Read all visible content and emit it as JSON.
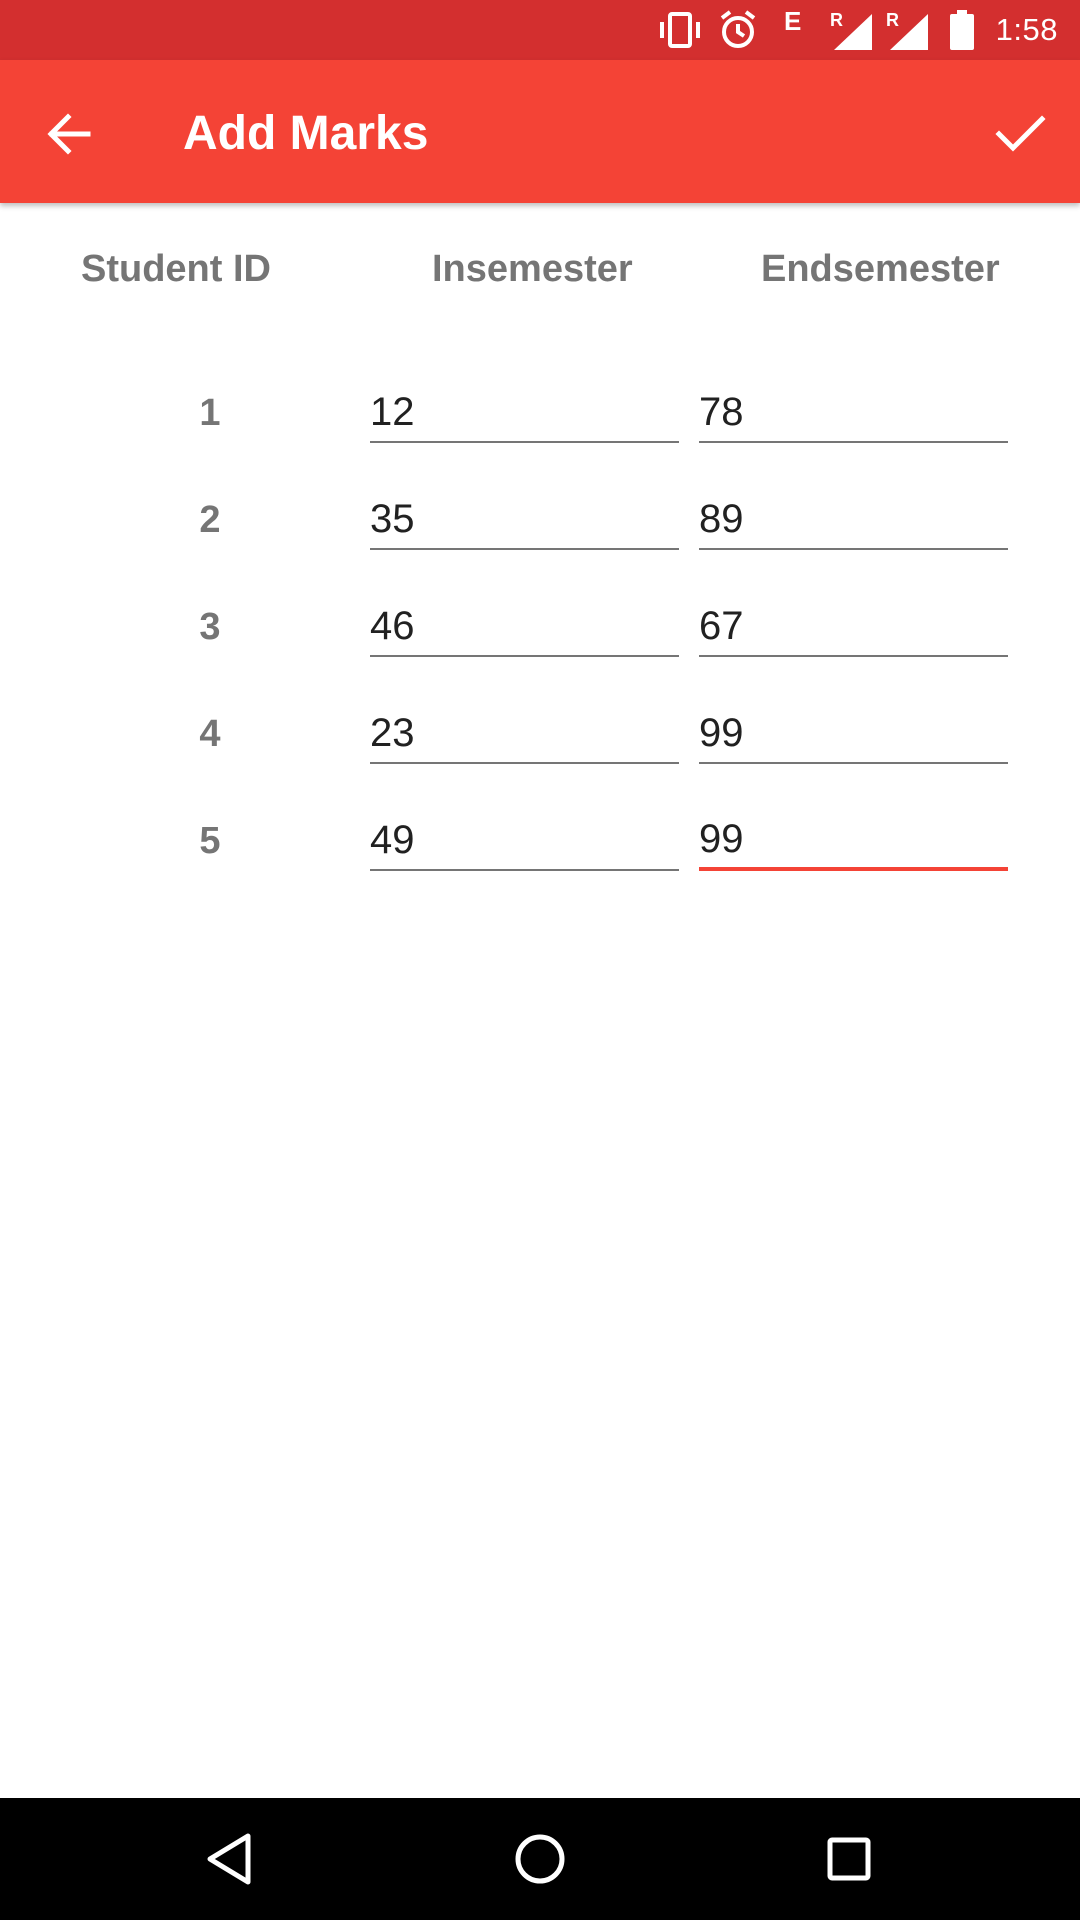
{
  "status_bar": {
    "time": "1:58",
    "network_type": "E",
    "icons": [
      "vibrate-icon",
      "alarm-icon",
      "signal-icon",
      "signal-icon",
      "battery-icon"
    ]
  },
  "toolbar": {
    "title": "Add Marks",
    "back_icon": "arrow-back-icon",
    "confirm_icon": "check-icon",
    "background_color": "#f44336"
  },
  "table": {
    "headers": [
      "Student ID",
      "Insemester",
      "Endsemester"
    ],
    "rows": [
      {
        "id": "1",
        "insemester": "12",
        "endsemester": "78"
      },
      {
        "id": "2",
        "insemester": "35",
        "endsemester": "89"
      },
      {
        "id": "3",
        "insemester": "46",
        "endsemester": "67"
      },
      {
        "id": "4",
        "insemester": "23",
        "endsemester": "99"
      },
      {
        "id": "5",
        "insemester": "49",
        "endsemester": "99"
      }
    ]
  },
  "nav_bar": {
    "icons": [
      "back-nav-icon",
      "home-nav-icon",
      "recents-nav-icon"
    ]
  },
  "colors": {
    "accent": "#f44336",
    "status_bar": "#d32f2f",
    "label_gray": "#757575"
  }
}
